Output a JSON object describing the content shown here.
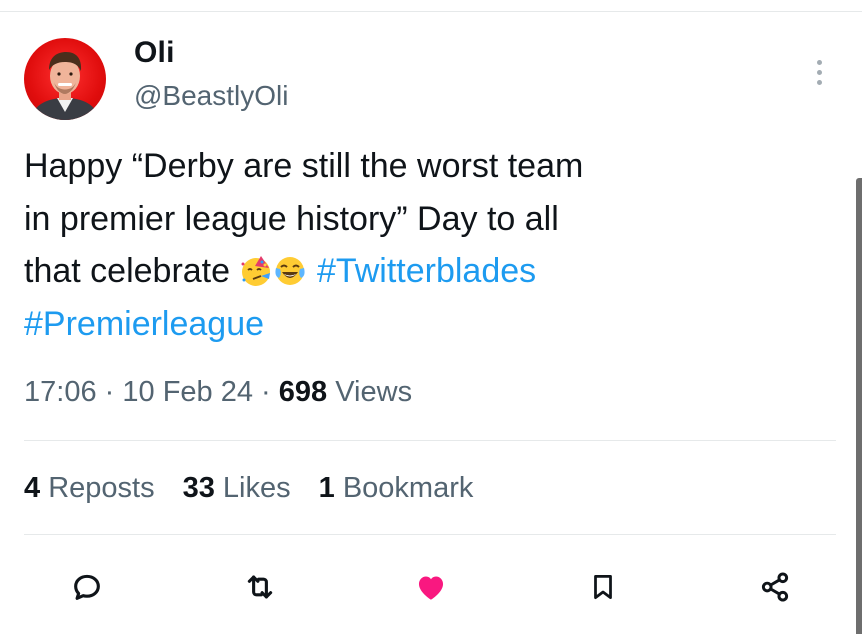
{
  "author": {
    "name": "Oli",
    "handle": "@BeastlyOli"
  },
  "tweet": {
    "line1": "Happy “Derby are still the worst team",
    "line2": "in premier league history” Day to all",
    "line3": "that celebrate ",
    "emojis": [
      "partying-face",
      "tears-of-joy"
    ],
    "hashtags": [
      "#Twitterblades",
      "#Premierleague"
    ]
  },
  "meta": {
    "time": "17:06",
    "date": "10 Feb 24",
    "views_count": "698",
    "views_label": "Views",
    "sep": "·"
  },
  "stats": {
    "reposts": {
      "count": "4",
      "label": "Reposts"
    },
    "likes": {
      "count": "33",
      "label": "Likes"
    },
    "bookmarks": {
      "count": "1",
      "label": "Bookmark"
    }
  },
  "actions": [
    "reply-icon",
    "repost-icon",
    "like-icon",
    "bookmark-icon",
    "share-icon"
  ],
  "colors": {
    "link": "#1d9bf0",
    "like": "#f91880",
    "secondary": "#536471",
    "text": "#0f1419"
  }
}
